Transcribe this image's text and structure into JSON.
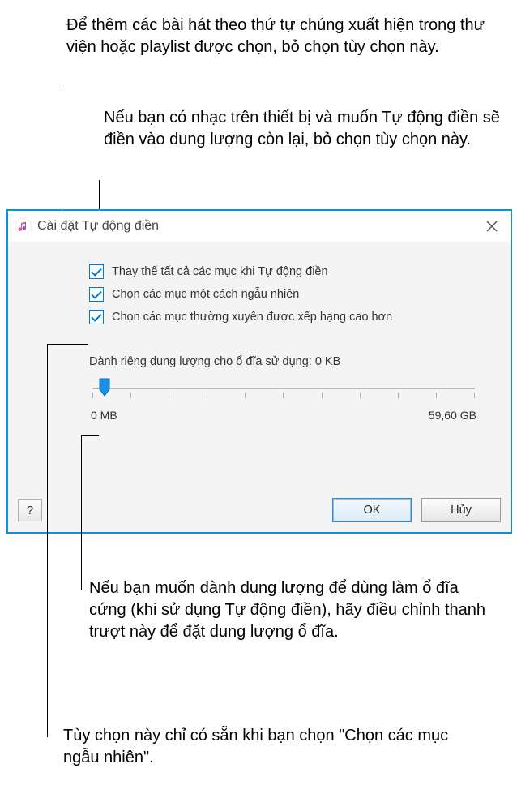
{
  "annotations": {
    "top1": "Để thêm các bài hát theo thứ tự chúng xuất hiện trong thư viện hoặc playlist được chọn, bỏ chọn tùy chọn này.",
    "top2": "Nếu bạn có nhạc trên thiết bị và muốn Tự động điền sẽ điền vào dung lượng còn lại, bỏ chọn tùy chọn này.",
    "bottom1": "Nếu bạn muốn dành dung lượng để dùng làm ổ đĩa cứng (khi sử dụng Tự động điền), hãy điều chỉnh thanh trượt này để đặt dung lượng ổ đĩa.",
    "bottom2": "Tùy chọn này chỉ có sẵn khi bạn chọn \"Chọn các mục ngẫu nhiên\"."
  },
  "dialog": {
    "title": "Cài đặt Tự động điền",
    "checkboxes": {
      "replace": "Thay thế tất cả các mục khi Tự động điền",
      "random": "Chọn các mục một cách ngẫu nhiên",
      "higher": "Chọn các mục thường xuyên được xếp hạng cao hơn"
    },
    "reserve_label": "Dành riêng dung lượng cho ổ đĩa sử dụng: 0 KB",
    "slider_min": "0 MB",
    "slider_max": "59,60 GB",
    "help": "?",
    "ok": "OK",
    "cancel": "Hủy"
  }
}
